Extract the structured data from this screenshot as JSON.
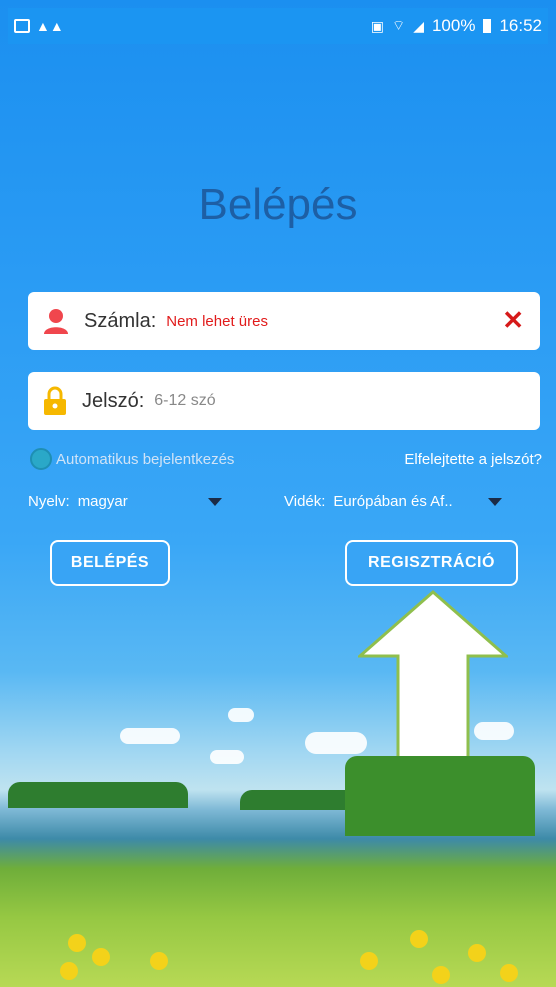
{
  "status_bar": {
    "battery": "100%",
    "time": "16:52"
  },
  "page": {
    "title": "Belépés"
  },
  "account_field": {
    "label": "Számla:",
    "error": "Nem lehet üres",
    "clear_icon": "close-icon"
  },
  "password_field": {
    "label": "Jelszó:",
    "placeholder": "6-12 szó"
  },
  "options": {
    "auto_login_label": "Automatikus bejelentkezés",
    "forgot_password": "Elfelejtette a jelszót?"
  },
  "selectors": {
    "language_label": "Nyelv:",
    "language_value": "magyar",
    "region_label": "Vidék:",
    "region_value": "Európában és Af.."
  },
  "buttons": {
    "login": "BELÉPÉS",
    "register": "REGISZTRÁCIÓ"
  },
  "colors": {
    "title": "#1d5fa5",
    "error": "#e11b1b",
    "button_fill": "#38a4f5",
    "accent": "#1b95f2"
  }
}
